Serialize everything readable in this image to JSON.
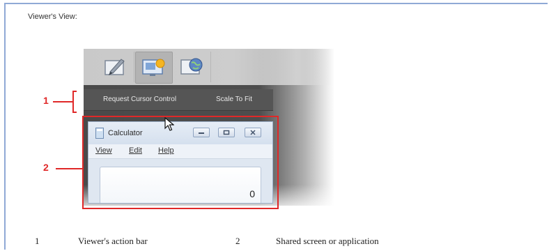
{
  "caption": "Viewer's View:",
  "toolbar": {
    "buttons": [
      {
        "icon": "annotate-icon"
      },
      {
        "icon": "share-screen-icon"
      },
      {
        "icon": "web-browser-icon"
      }
    ]
  },
  "action_bar": {
    "items": [
      "Request Cursor Control",
      "Scale To Fit"
    ]
  },
  "callouts": {
    "one": "1",
    "two": "2"
  },
  "calculator": {
    "title": "Calculator",
    "menu": [
      "View",
      "Edit",
      "Help"
    ],
    "display_value": "0"
  },
  "legend": [
    {
      "number": "1",
      "text": "Viewer's action bar"
    },
    {
      "number": "2",
      "text": "Shared screen or application"
    }
  ],
  "colors": {
    "highlight": "#e02828",
    "frame": "#8fa9d6",
    "action_bar": "#555555"
  }
}
